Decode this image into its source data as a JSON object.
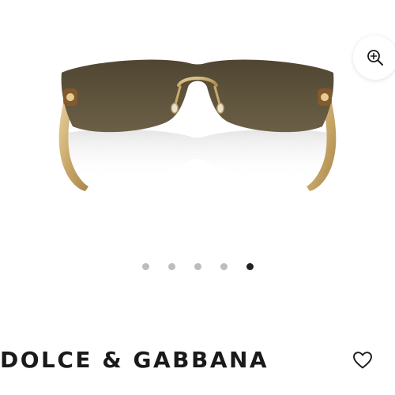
{
  "product": {
    "brand": "DOLCE & GABBANA",
    "image_icon": "sunglasses-product-image"
  },
  "zoom": {
    "icon": "zoom-in-icon"
  },
  "favorite": {
    "icon": "heart-outline-icon"
  },
  "carousel": {
    "total": 5,
    "active_index": 4
  },
  "colors": {
    "lens": "#5e533c",
    "frame_gold": "#c9a86a",
    "dot_inactive": "#bdbdbd",
    "dot_active": "#222222",
    "text": "#1a1a1a"
  }
}
